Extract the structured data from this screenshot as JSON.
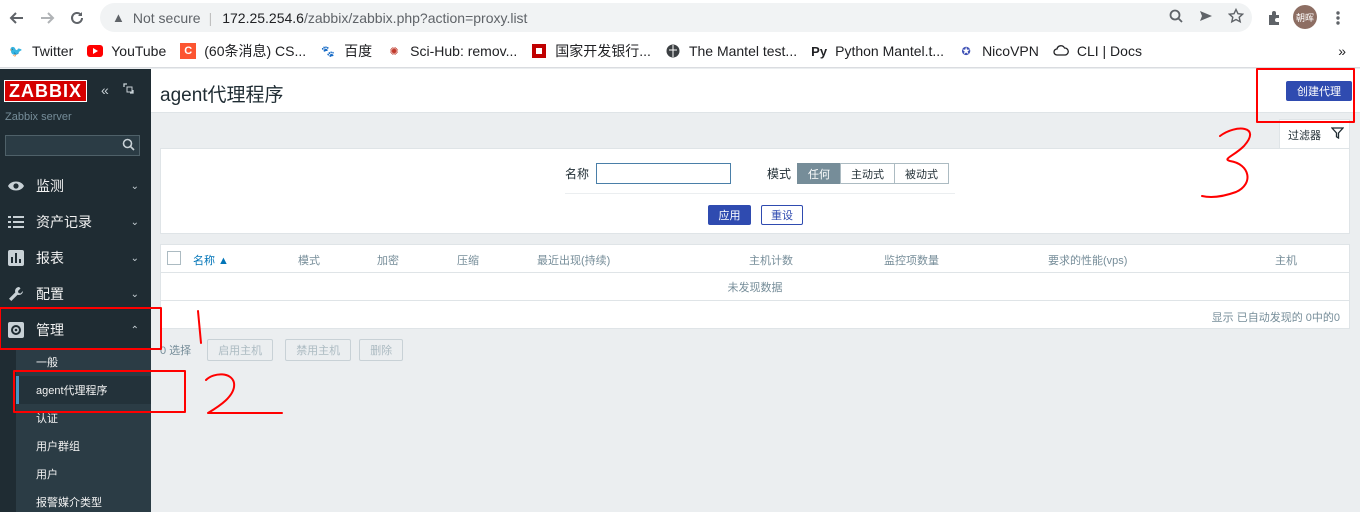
{
  "browser": {
    "security": "Not secure",
    "url_host": "172.25.254.6",
    "url_path": "/zabbix/zabbix.php?action=proxy.list",
    "avatar_text": "朝晖",
    "bookmarks": [
      {
        "label": "Twitter",
        "icon": "twitter-bird-icon",
        "color": "#1d9bf0"
      },
      {
        "label": "YouTube",
        "icon": "youtube-play-icon",
        "color": "#ff0000"
      },
      {
        "label": "(60条消息) CS...",
        "icon": "csdn-icon",
        "color": "#fc5531"
      },
      {
        "label": "百度",
        "icon": "baidu-paw-icon",
        "color": "#2932e1"
      },
      {
        "label": "Sci-Hub: remov...",
        "icon": "scihub-icon",
        "color": "#c0392b"
      },
      {
        "label": "国家开发银行...",
        "icon": "cdb-icon",
        "color": "#c00000"
      },
      {
        "label": "The Mantel test...",
        "icon": "globe-icon",
        "color": "#202124"
      },
      {
        "label": "Python Mantel.t...",
        "icon": "pypi-icon",
        "color": "#202124"
      },
      {
        "label": "NicoVPN",
        "icon": "nicovpn-icon",
        "color": "#3f51b5"
      },
      {
        "label": "CLI | Docs",
        "icon": "cloud-icon",
        "color": "#202124"
      }
    ],
    "more": "»"
  },
  "sidebar": {
    "logo": "ZABBIX",
    "server": "Zabbix server",
    "menu": [
      {
        "label": "监测",
        "icon": "eye-icon"
      },
      {
        "label": "资产记录",
        "icon": "list-icon"
      },
      {
        "label": "报表",
        "icon": "bar-chart-icon"
      },
      {
        "label": "配置",
        "icon": "wrench-icon"
      },
      {
        "label": "管理",
        "icon": "gear-icon"
      }
    ],
    "submenu": [
      "一般",
      "agent代理程序",
      "认证",
      "用户群组",
      "用户",
      "报警媒介类型"
    ]
  },
  "header": {
    "title": "agent代理程序",
    "create_label": "创建代理"
  },
  "filter": {
    "tab_label": "过滤器",
    "name_label": "名称",
    "name_value": "",
    "mode_label": "模式",
    "mode_options": [
      "任何",
      "主动式",
      "被动式"
    ],
    "mode_selected": "任何",
    "apply_label": "应用",
    "reset_label": "重设"
  },
  "table": {
    "columns": [
      "名称 ▲",
      "模式",
      "加密",
      "压缩",
      "最近出现(持续)",
      "主机计数",
      "监控项数量",
      "要求的性能(vps)",
      "主机"
    ],
    "empty_text": "未发现数据",
    "footer": "显示 已自动发现的 0中的0"
  },
  "actions": {
    "selected": "0 选择",
    "buttons": [
      "启用主机",
      "禁用主机",
      "删除"
    ]
  },
  "annotations": {
    "color": "#ff0000",
    "marks": [
      "1",
      "2",
      "3"
    ]
  }
}
